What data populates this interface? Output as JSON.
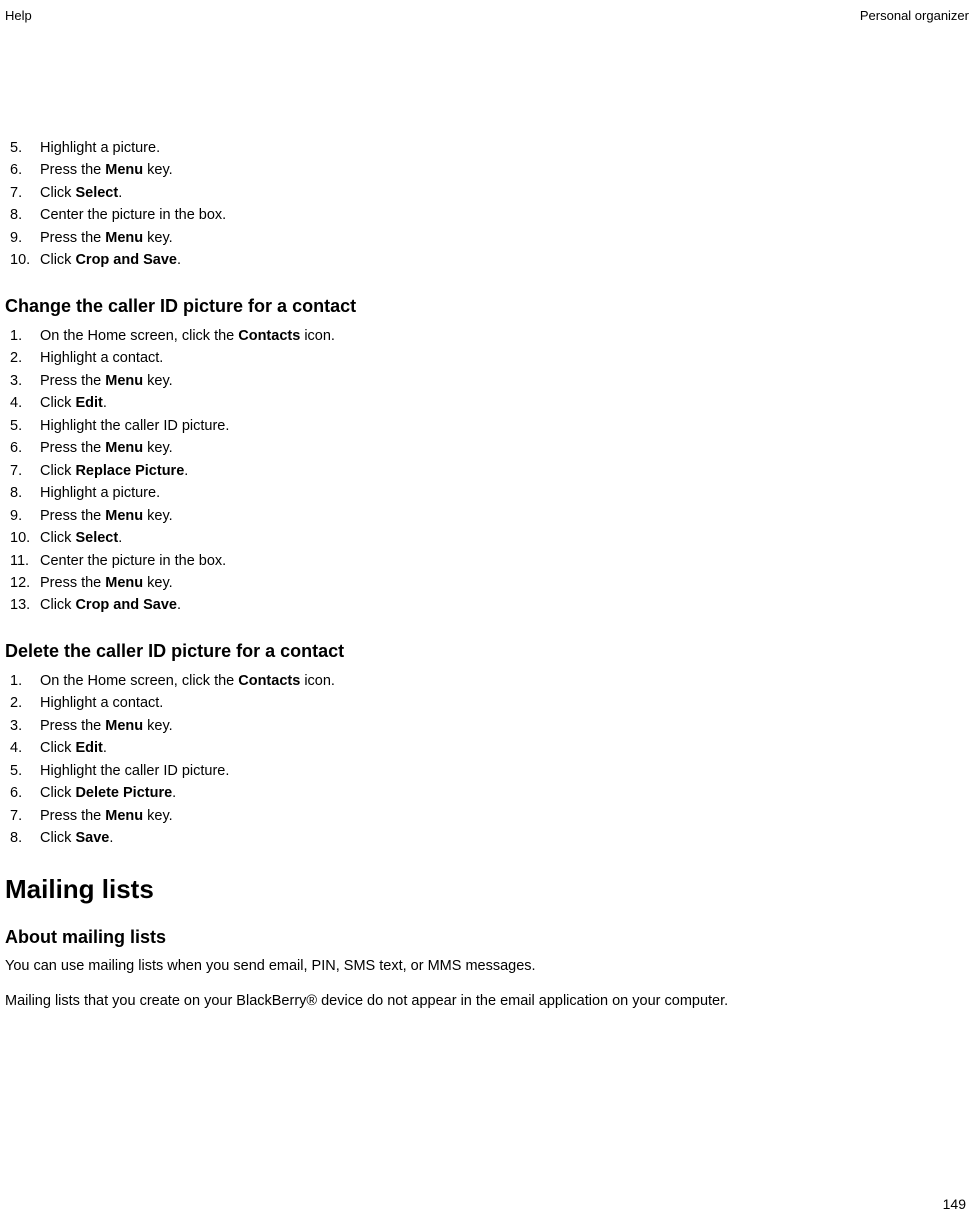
{
  "header": {
    "left": "Help",
    "right": "Personal organizer"
  },
  "section1": {
    "items": [
      {
        "num": "5.",
        "pre": "Highlight a picture.",
        "b": "",
        "post": ""
      },
      {
        "num": "6.",
        "pre": "Press the ",
        "b": "Menu",
        "post": " key."
      },
      {
        "num": "7.",
        "pre": "Click ",
        "b": "Select",
        "post": "."
      },
      {
        "num": "8.",
        "pre": "Center the picture in the box.",
        "b": "",
        "post": ""
      },
      {
        "num": "9.",
        "pre": "Press the ",
        "b": "Menu",
        "post": " key."
      },
      {
        "num": "10.",
        "pre": "Click ",
        "b": "Crop and Save",
        "post": "."
      }
    ]
  },
  "section2": {
    "heading": "Change the caller ID picture for a contact",
    "items": [
      {
        "num": "1.",
        "pre": "On the Home screen, click the ",
        "b": "Contacts",
        "post": " icon."
      },
      {
        "num": "2.",
        "pre": "Highlight a contact.",
        "b": "",
        "post": ""
      },
      {
        "num": "3.",
        "pre": "Press the ",
        "b": "Menu",
        "post": " key."
      },
      {
        "num": "4.",
        "pre": "Click ",
        "b": "Edit",
        "post": "."
      },
      {
        "num": "5.",
        "pre": "Highlight the caller ID picture.",
        "b": "",
        "post": ""
      },
      {
        "num": "6.",
        "pre": "Press the ",
        "b": "Menu",
        "post": " key."
      },
      {
        "num": "7.",
        "pre": "Click ",
        "b": "Replace Picture",
        "post": "."
      },
      {
        "num": "8.",
        "pre": "Highlight a picture.",
        "b": "",
        "post": ""
      },
      {
        "num": "9.",
        "pre": "Press the ",
        "b": "Menu",
        "post": " key."
      },
      {
        "num": "10.",
        "pre": "Click ",
        "b": "Select",
        "post": "."
      },
      {
        "num": "11.",
        "pre": "Center the picture in the box.",
        "b": "",
        "post": ""
      },
      {
        "num": "12.",
        "pre": "Press the ",
        "b": "Menu",
        "post": " key."
      },
      {
        "num": "13.",
        "pre": "Click ",
        "b": "Crop and Save",
        "post": "."
      }
    ]
  },
  "section3": {
    "heading": "Delete the caller ID picture for a contact",
    "items": [
      {
        "num": "1.",
        "pre": "On the Home screen, click the ",
        "b": "Contacts",
        "post": " icon."
      },
      {
        "num": "2.",
        "pre": "Highlight a contact.",
        "b": "",
        "post": ""
      },
      {
        "num": "3.",
        "pre": "Press the ",
        "b": "Menu",
        "post": " key."
      },
      {
        "num": "4.",
        "pre": "Click ",
        "b": "Edit",
        "post": "."
      },
      {
        "num": "5.",
        "pre": "Highlight the caller ID picture.",
        "b": "",
        "post": ""
      },
      {
        "num": "6.",
        "pre": "Click ",
        "b": "Delete Picture",
        "post": "."
      },
      {
        "num": "7.",
        "pre": "Press the ",
        "b": "Menu",
        "post": " key."
      },
      {
        "num": "8.",
        "pre": "Click ",
        "b": "Save",
        "post": "."
      }
    ]
  },
  "section4": {
    "h1": "Mailing lists",
    "h2": "About mailing lists",
    "p1": "You can use mailing lists when you send email, PIN, SMS text, or MMS messages.",
    "p2": "Mailing lists that you create on your BlackBerry® device do not appear in the email application on your computer."
  },
  "page_number": "149"
}
